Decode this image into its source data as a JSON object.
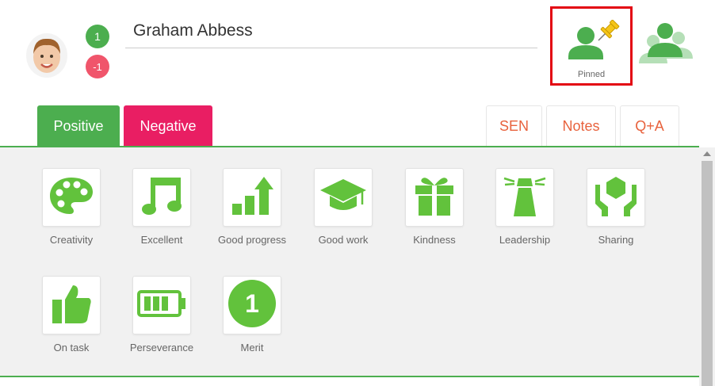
{
  "student": {
    "name": "Graham Abbess",
    "positive_count": "1",
    "negative_count": "-1"
  },
  "pin": {
    "label": "Pinned"
  },
  "tabs": {
    "positive": "Positive",
    "negative": "Negative",
    "sen": "SEN",
    "notes": "Notes",
    "qa": "Q+A"
  },
  "behaviours": [
    {
      "label": "Creativity",
      "icon": "palette-icon"
    },
    {
      "label": "Excellent",
      "icon": "music-note-icon"
    },
    {
      "label": "Good progress",
      "icon": "progress-chart-icon"
    },
    {
      "label": "Good work",
      "icon": "graduation-cap-icon"
    },
    {
      "label": "Kindness",
      "icon": "gift-icon"
    },
    {
      "label": "Leadership",
      "icon": "lighthouse-icon"
    },
    {
      "label": "Sharing",
      "icon": "hands-cube-icon"
    },
    {
      "label": "On task",
      "icon": "thumbs-up-icon"
    },
    {
      "label": "Perseverance",
      "icon": "battery-icon"
    },
    {
      "label": "Merit",
      "icon": "merit-one-icon",
      "icon_text": "1"
    }
  ],
  "colors": {
    "accent_green": "#4cae4f",
    "icon_green": "#62c23c",
    "negative_pink": "#e91e63",
    "tab_text_orange": "#e8623d",
    "highlight_red": "#e30613"
  }
}
